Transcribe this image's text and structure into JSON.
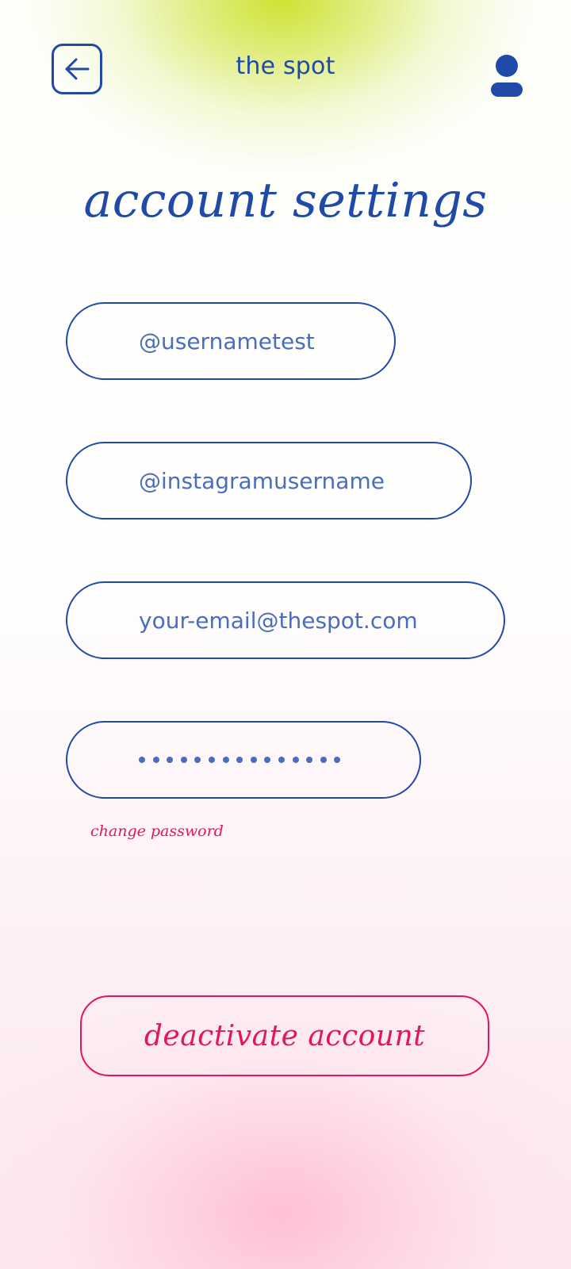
{
  "header": {
    "back_icon": "arrow-left-icon",
    "app_title": "the spot",
    "profile_icon": "user-icon"
  },
  "page": {
    "title": "account settings"
  },
  "form": {
    "username": "@usernametest",
    "instagram": "@instagramusername",
    "email": "your-email@thespot.com",
    "password_mask_length": 15,
    "change_password_label": "change password"
  },
  "actions": {
    "deactivate_label": "deactivate account"
  },
  "colors": {
    "primary_blue": "#1f4aa8",
    "field_text_blue": "#4a6dbd",
    "accent_pink": "#e3155e",
    "top_glow": "#cfe22a",
    "bottom_glow": "#ffc2d6"
  }
}
